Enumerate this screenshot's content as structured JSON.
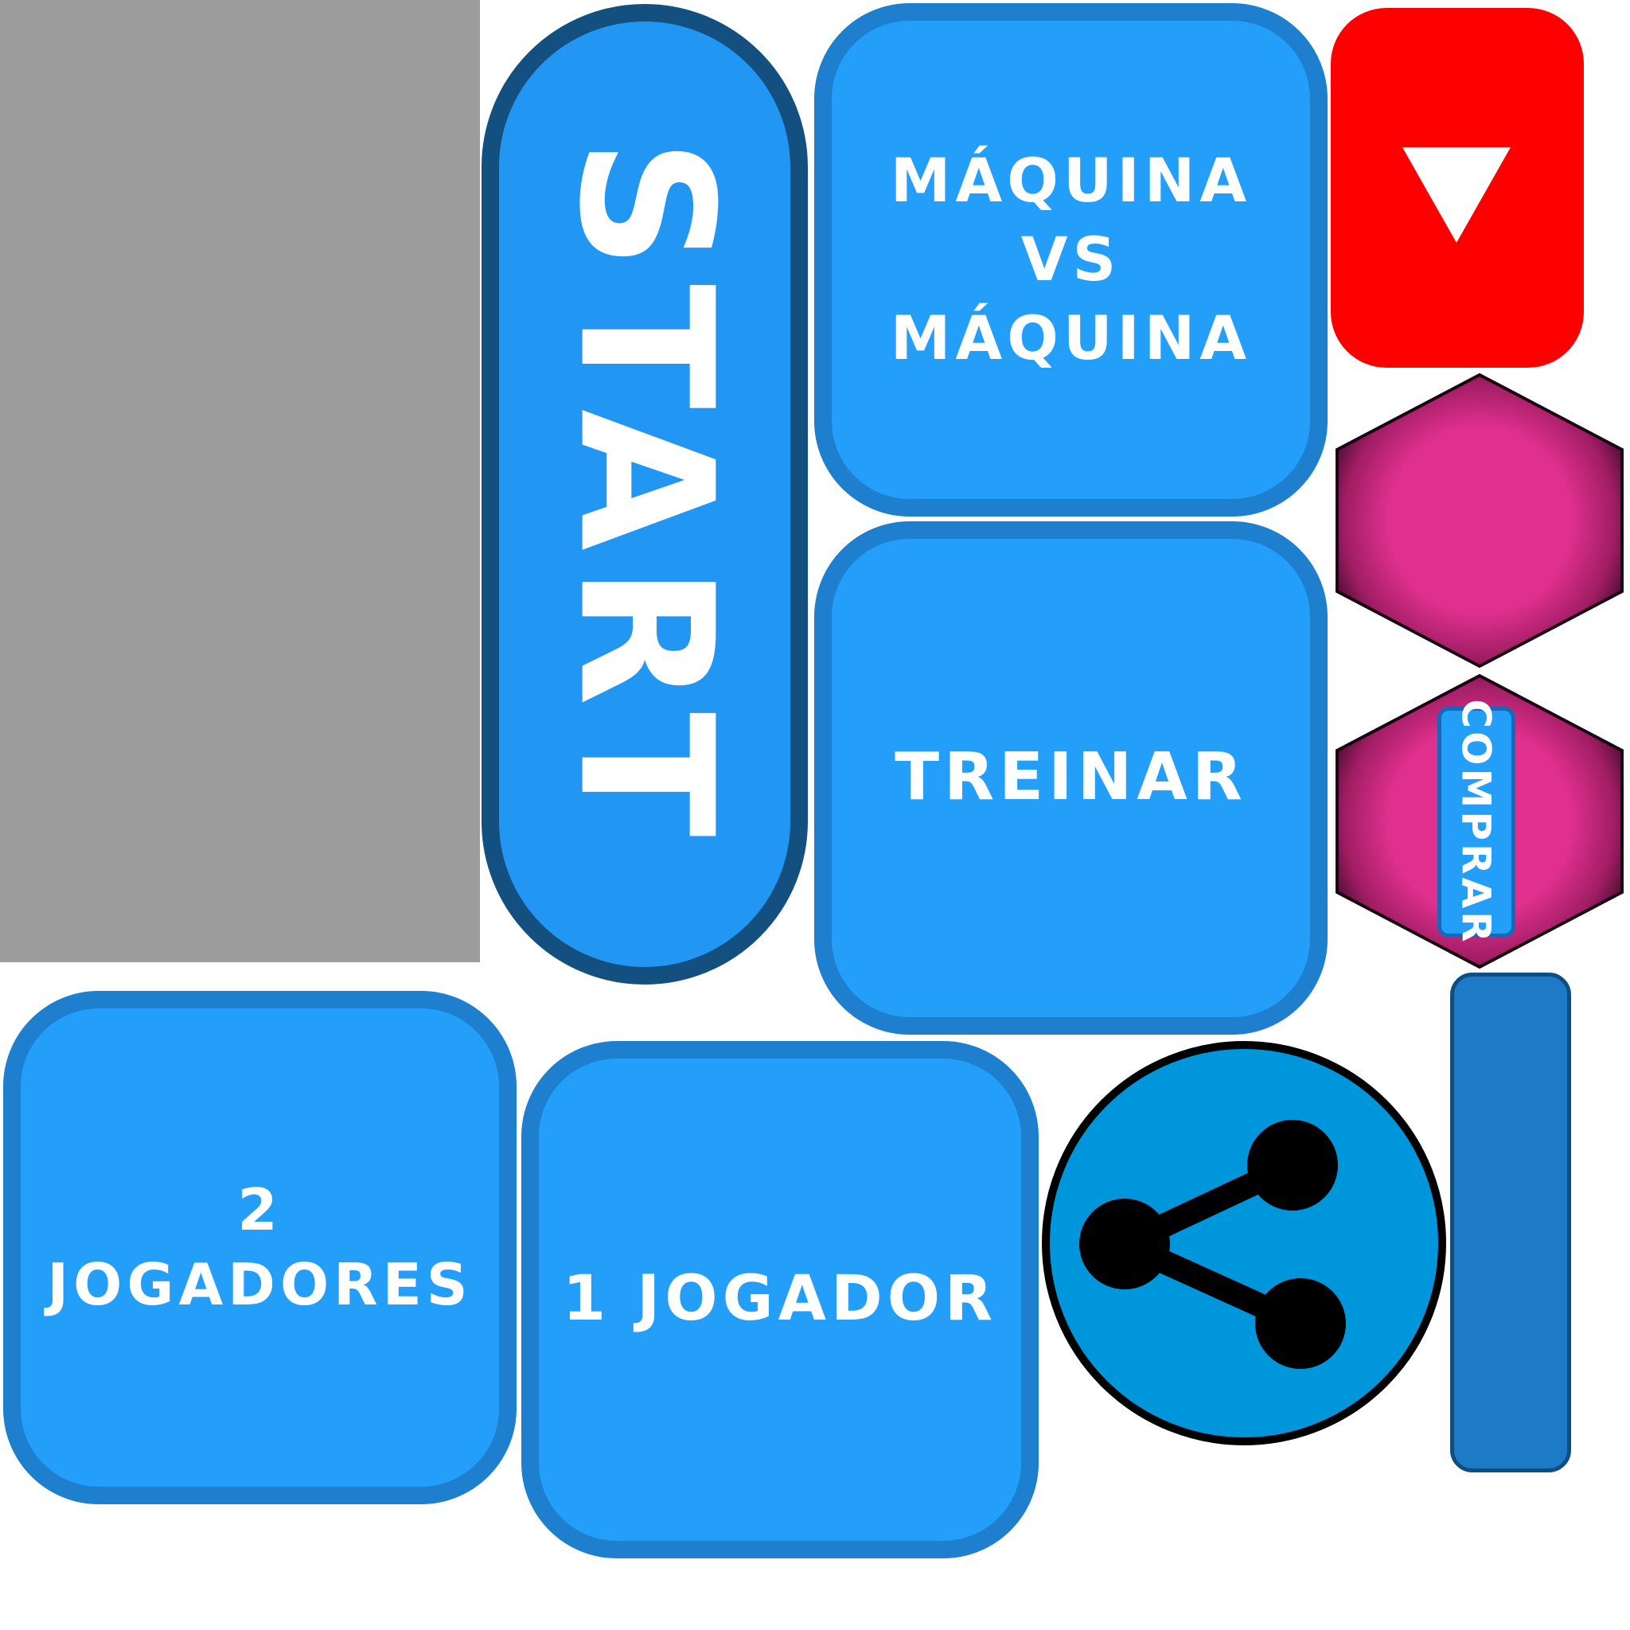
{
  "buttons": {
    "start": "START",
    "maquina_vs_maquina": "MÁQUINA\nVS\nMÁQUINA",
    "treinar": "TREINAR",
    "dois_jogadores": "2\nJOGADORES",
    "um_jogador": "1 JOGADOR",
    "comprar": "COMPRAR"
  },
  "icons": {
    "youtube": "play-triangle-icon",
    "share": "share-icon",
    "hexagon": "hexagon-icon"
  },
  "colors": {
    "tile_fill": "#239ef9",
    "tile_border": "#1f7fcf",
    "start_border": "#14507f",
    "youtube_red": "#ff0000",
    "hex_pink": "#e0308e",
    "hex_dark": "#3a0a2a",
    "share_blue": "#0096dc",
    "placeholder_gray": "#9c9c9c"
  }
}
